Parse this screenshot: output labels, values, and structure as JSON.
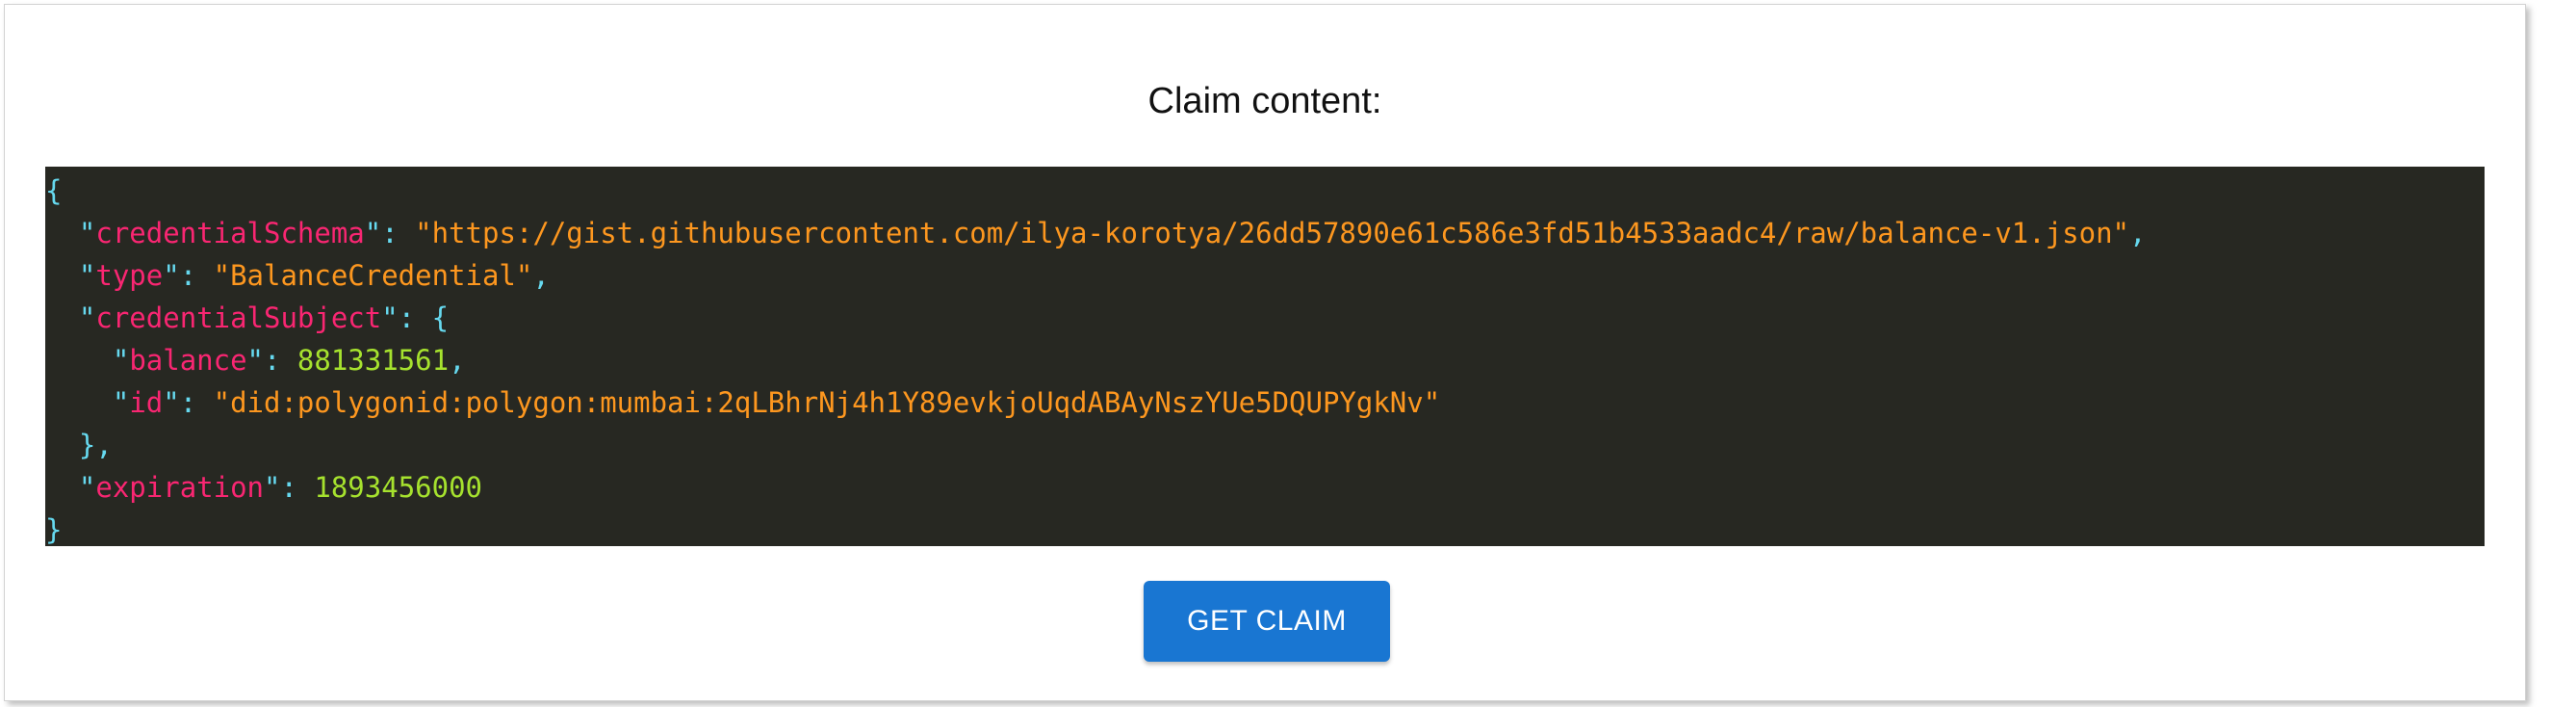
{
  "title": "Claim content:",
  "button_label": "GET CLAIM",
  "colors": {
    "code_background": "#272822",
    "punctuation": "#66d9ef",
    "key": "#f92672",
    "string": "#fd971f",
    "number": "#a6e22e",
    "button": "#1976d2"
  },
  "code_lines": [
    [
      {
        "t": "punct",
        "v": "{"
      }
    ],
    [
      {
        "t": "punct",
        "v": "  \""
      },
      {
        "t": "key",
        "v": "credentialSchema"
      },
      {
        "t": "punct",
        "v": "\": "
      },
      {
        "t": "str",
        "v": "\"https://gist.githubusercontent.com/ilya-korotya/26dd57890e61c586e3fd51b4533aadc4/raw/balance-v1.json\""
      },
      {
        "t": "punct",
        "v": ","
      }
    ],
    [
      {
        "t": "punct",
        "v": "  \""
      },
      {
        "t": "key",
        "v": "type"
      },
      {
        "t": "punct",
        "v": "\": "
      },
      {
        "t": "str",
        "v": "\"BalanceCredential\""
      },
      {
        "t": "punct",
        "v": ","
      }
    ],
    [
      {
        "t": "punct",
        "v": "  \""
      },
      {
        "t": "key",
        "v": "credentialSubject"
      },
      {
        "t": "punct",
        "v": "\": {"
      }
    ],
    [
      {
        "t": "punct",
        "v": "    \""
      },
      {
        "t": "key",
        "v": "balance"
      },
      {
        "t": "punct",
        "v": "\": "
      },
      {
        "t": "num",
        "v": "881331561"
      },
      {
        "t": "punct",
        "v": ","
      }
    ],
    [
      {
        "t": "punct",
        "v": "    \""
      },
      {
        "t": "key",
        "v": "id"
      },
      {
        "t": "punct",
        "v": "\": "
      },
      {
        "t": "str",
        "v": "\"did:polygonid:polygon:mumbai:2qLBhrNj4h1Y89evkjoUqdABAyNszYUe5DQUPYgkNv\""
      }
    ],
    [
      {
        "t": "punct",
        "v": "  },"
      }
    ],
    [
      {
        "t": "punct",
        "v": "  \""
      },
      {
        "t": "key",
        "v": "expiration"
      },
      {
        "t": "punct",
        "v": "\": "
      },
      {
        "t": "num",
        "v": "1893456000"
      }
    ],
    [
      {
        "t": "punct",
        "v": "}"
      }
    ]
  ]
}
